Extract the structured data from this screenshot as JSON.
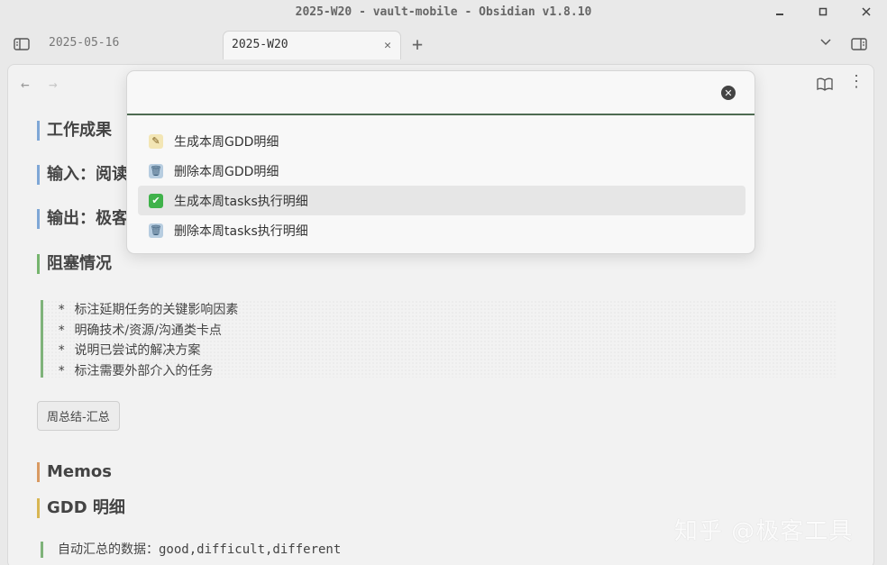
{
  "window": {
    "title": "2025-W20 - vault-mobile - Obsidian v1.8.10",
    "minimize_label": "_",
    "maximize_label": "□",
    "close_label": "✕"
  },
  "tabs": {
    "inactive_label": "2025-05-16",
    "active_label": "2025-W20",
    "close_label": "✕",
    "add_label": "+",
    "dropdown_label": "⌄"
  },
  "nav": {
    "back_label": "←",
    "forward_label": "→",
    "more_label": "⋮"
  },
  "document": {
    "headings": [
      "工作成果",
      "输入：阅读",
      "输出：极客",
      "阻塞情况",
      "Memos",
      "GDD 明细"
    ],
    "blockers": [
      "标注延期任务的关键影响因素",
      "明确技术/资源/沟通类卡点",
      "说明已尝试的解决方案",
      "标注需要外部介入的任务"
    ],
    "bullet": "*",
    "summary_button": "周总结-汇总",
    "auto_line": {
      "label": "自动汇总的数据：",
      "value": "good,difficult,different"
    }
  },
  "modal": {
    "input_value": "",
    "input_placeholder": "",
    "clear_label": "✕",
    "commands": [
      {
        "label": "生成本周GDD明细",
        "icon": "memo-icon",
        "glyph": "✎"
      },
      {
        "label": "删除本周GDD明细",
        "icon": "trash-icon",
        "glyph": "🗑"
      },
      {
        "label": "生成本周tasks执行明细",
        "icon": "check-icon",
        "glyph": "✔",
        "active": true
      },
      {
        "label": "删除本周tasks执行明细",
        "icon": "trash-icon",
        "glyph": "🗑"
      }
    ]
  },
  "watermark": "知乎 @极客工具"
}
